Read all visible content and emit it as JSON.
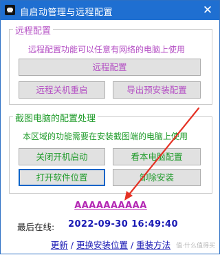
{
  "window": {
    "title": "自启动管理与远程配置",
    "close_glyph": "✕"
  },
  "remote_group": {
    "legend": "远程配置",
    "desc": "远程配置功能可以任意有网络的电脑上使用",
    "btn_remote_config": "远程配置",
    "btn_remote_shutdown": "远程关机重启",
    "btn_export": "导出预安装配置"
  },
  "local_group": {
    "legend": "截图电脑的配置处理",
    "desc": "本区域的功能需要在安装截图端的电脑上使用",
    "btn_close_autostart": "关闭开机启动",
    "btn_view_config": "看本电脑配置",
    "btn_open_location": "打开软件位置",
    "btn_uninstall": "卸除安装"
  },
  "link_a": "AAAAAAAAAA",
  "last_online": {
    "label": "最后在线:",
    "value": "2022-09-30 16:49:40"
  },
  "bottom_links": {
    "update": "更新",
    "change": "更换安装位置",
    "reinstall": "重装方法",
    "sep": " / "
  },
  "colors": {
    "titlebar": "#1f6fd1",
    "pink": "#b44fc4",
    "green": "#1f9b2a",
    "link": "#1a1ab4",
    "arrow": "#e53225"
  },
  "icons": {
    "app": "app-logo-icon",
    "close": "close-icon",
    "arrow": "red-annotation-arrow"
  }
}
